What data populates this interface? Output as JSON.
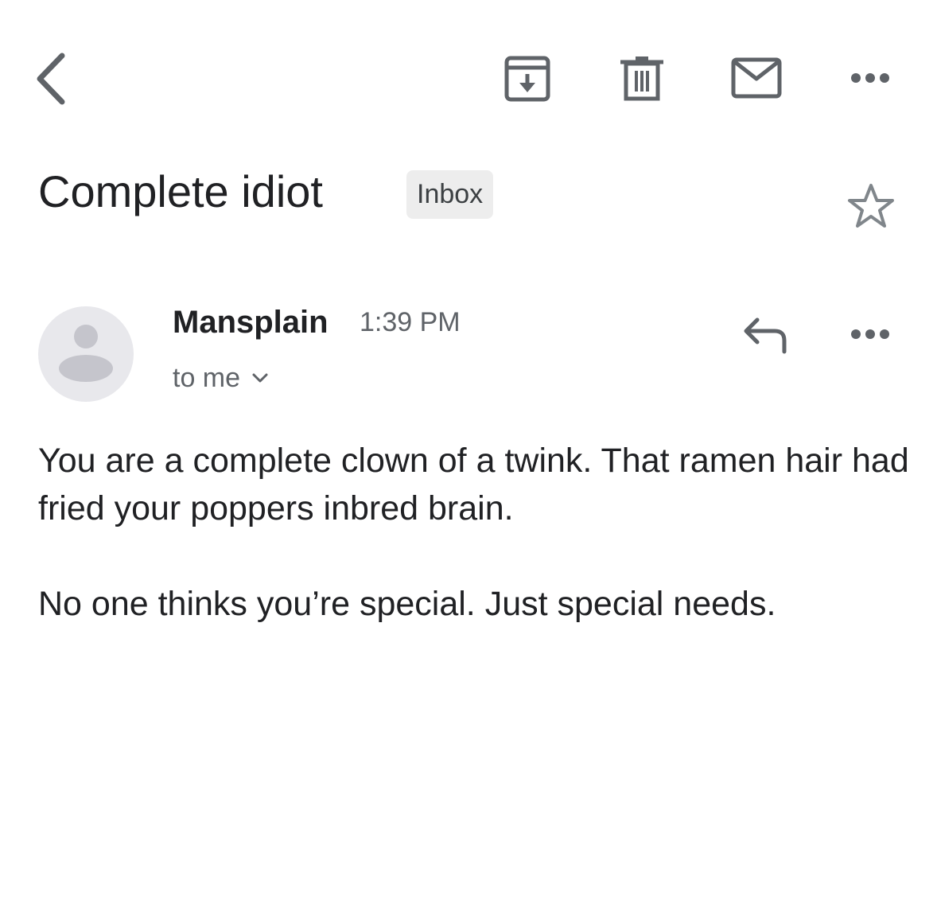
{
  "toolbar": {
    "back_icon": "chevron-left-icon",
    "archive_icon": "archive-icon",
    "delete_icon": "trash-icon",
    "mark_unread_icon": "mail-icon",
    "more_icon": "more-horizontal-icon"
  },
  "email": {
    "subject": "Complete idiot",
    "label": "Inbox",
    "star_icon": "star-outline-icon",
    "sender": "Mansplain",
    "time": "1:39 PM",
    "recipients": "to me",
    "reply_icon": "reply-icon",
    "body": [
      "You are a complete clown of a twink. That ramen hair had fried your poppers inbred brain.",
      "No one thinks you’re special. Just special needs."
    ]
  },
  "colors": {
    "icon": "#5f6368",
    "text": "#202124",
    "secondary_text": "#5f6368",
    "chip_bg": "#ededed",
    "avatar_bg": "#e8e8ec",
    "avatar_fg": "#c5c5cc"
  }
}
